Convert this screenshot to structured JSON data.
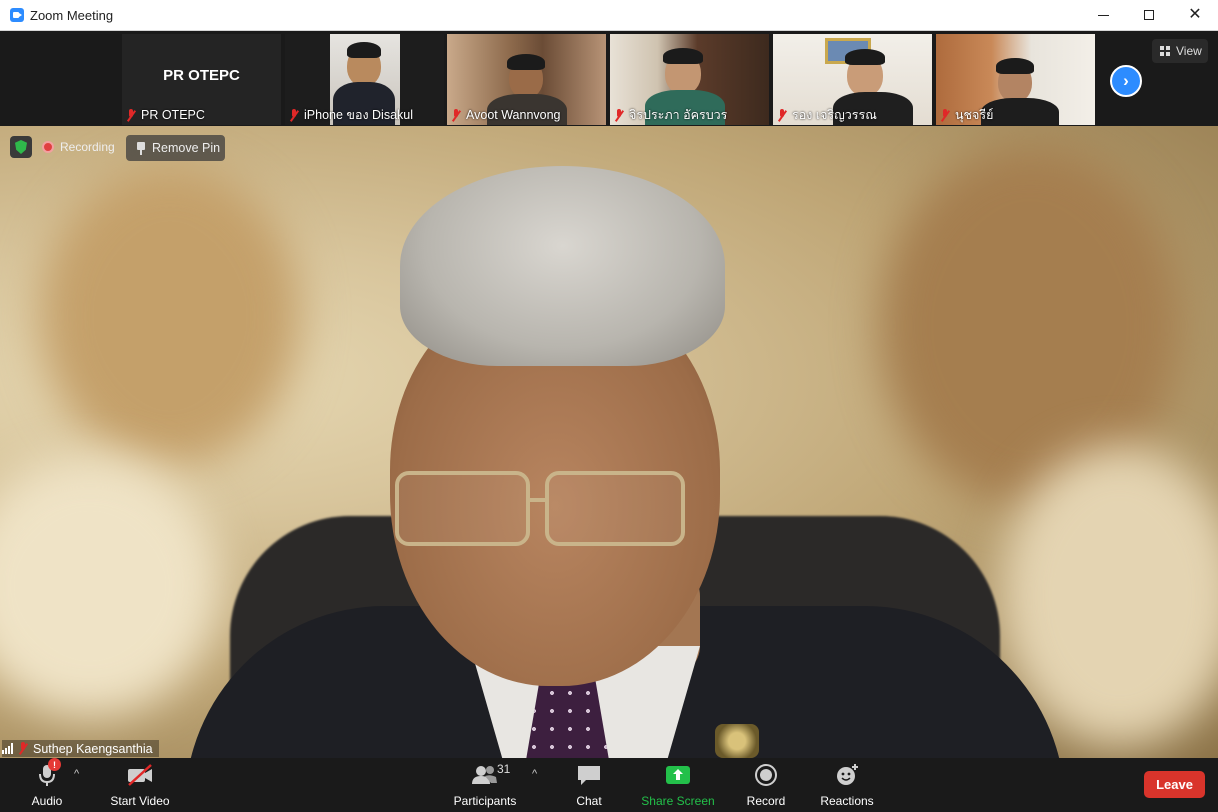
{
  "window": {
    "title": "Zoom Meeting"
  },
  "strip": {
    "tiles": [
      {
        "name": "PR OTEPC",
        "big_name": "PR OTEPC"
      },
      {
        "name": "iPhone ของ Disakul"
      },
      {
        "name": "Avoot Wannvong"
      },
      {
        "name": "จิรประภา อัครบวร"
      },
      {
        "name": "รอง เจริญวรรณ"
      },
      {
        "name": "นุชจรีย์"
      }
    ],
    "view_label": "View"
  },
  "status": {
    "recording_label": "Recording",
    "remove_pin_label": "Remove Pin"
  },
  "main": {
    "speaker_name": "Suthep Kaengsanthia"
  },
  "toolbar": {
    "audio_label": "Audio",
    "start_video_label": "Start Video",
    "participants_label": "Participants",
    "participants_count": "31",
    "chat_label": "Chat",
    "share_screen_label": "Share Screen",
    "record_label": "Record",
    "reactions_label": "Reactions",
    "leave_label": "Leave",
    "audio_badge": "!"
  },
  "colors": {
    "accent": "#2d8cff",
    "share_green": "#23c04a",
    "leave_red": "#d9342b",
    "muted_red": "#e02828"
  },
  "icons": [
    "zoom-app-icon",
    "minimize-icon",
    "maximize-icon",
    "close-icon",
    "muted-mic-icon",
    "grid-view-icon",
    "chevron-right-icon",
    "security-shield-icon",
    "record-dot-icon",
    "pin-icon",
    "signal-icon",
    "microphone-icon",
    "video-off-icon",
    "participants-icon",
    "chat-icon",
    "share-screen-icon",
    "record-icon",
    "reactions-icon"
  ]
}
